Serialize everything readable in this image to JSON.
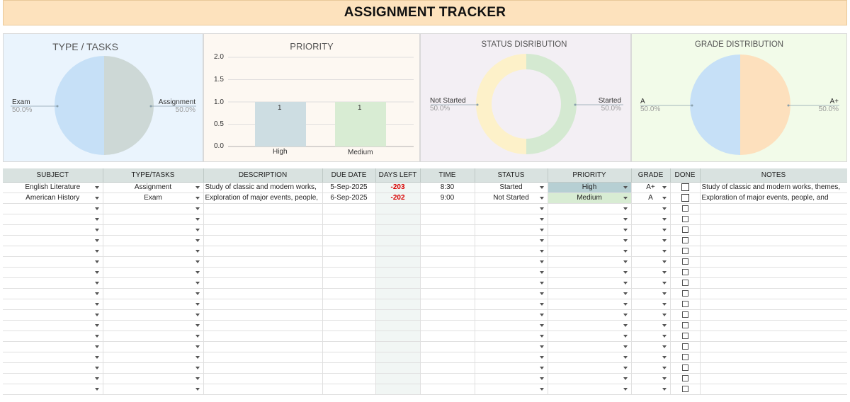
{
  "title": "ASSIGNMENT TRACKER",
  "panels": {
    "type_tasks": {
      "title": "TYPE / TASKS",
      "slices": [
        {
          "label": "Exam",
          "pct": "50.0%",
          "color": "#c6e0f7"
        },
        {
          "label": "Assignment",
          "pct": "50.0%",
          "color": "#cdd8d6"
        }
      ]
    },
    "priority": {
      "title": "PRIORITY",
      "y_ticks": [
        "2.0",
        "1.5",
        "1.0",
        "0.5",
        "0.0"
      ],
      "bar_labels": [
        "1",
        "1"
      ]
    },
    "status": {
      "title": "STATUS DISRIBUTION",
      "slices": [
        {
          "label": "Not Started",
          "pct": "50.0%",
          "color": "#fdf1c9"
        },
        {
          "label": "Started",
          "pct": "50.0%",
          "color": "#d4e9d1"
        }
      ]
    },
    "grade": {
      "title": "GRADE DISTRIBUTION",
      "slices": [
        {
          "label": "A",
          "pct": "50.0%",
          "color": "#c6e0f7"
        },
        {
          "label": "A+",
          "pct": "50.0%",
          "color": "#fde0bd"
        }
      ]
    }
  },
  "chart_data": [
    {
      "type": "pie",
      "title": "TYPE / TASKS",
      "categories": [
        "Exam",
        "Assignment"
      ],
      "values": [
        50.0,
        50.0
      ]
    },
    {
      "type": "bar",
      "title": "PRIORITY",
      "categories": [
        "High",
        "Medium"
      ],
      "values": [
        1,
        1
      ],
      "ylim": [
        0,
        2.0
      ],
      "grid": true,
      "colors": [
        "#cddde2",
        "#d8ecd3"
      ]
    },
    {
      "type": "pie",
      "title": "STATUS DISRIBUTION",
      "categories": [
        "Not Started",
        "Started"
      ],
      "values": [
        50.0,
        50.0
      ],
      "donut": true
    },
    {
      "type": "pie",
      "title": "GRADE DISTRIBUTION",
      "categories": [
        "A",
        "A+"
      ],
      "values": [
        50.0,
        50.0
      ]
    }
  ],
  "table": {
    "headers": [
      "SUBJECT",
      "TYPE/TASKS",
      "DESCRIPTION",
      "DUE DATE",
      "DAYS LEFT",
      "TIME",
      "STATUS",
      "PRIORITY",
      "GRADE",
      "DONE",
      "NOTES"
    ],
    "rows": [
      {
        "subject": "English Literature",
        "type": "Assignment",
        "description": "Study of classic and modern works,",
        "due": "5-Sep-2025",
        "days_left": "-203",
        "time": "8:30",
        "status": "Started",
        "priority": "High",
        "grade": "A+",
        "notes": "Study of classic and modern works, themes,"
      },
      {
        "subject": "American History",
        "type": "Exam",
        "description": "Exploration of major events, people,",
        "due": "6-Sep-2025",
        "days_left": "-202",
        "time": "9:00",
        "status": "Not Started",
        "priority": "Medium",
        "grade": "A",
        "notes": "Exploration of major events, people, and"
      }
    ]
  }
}
